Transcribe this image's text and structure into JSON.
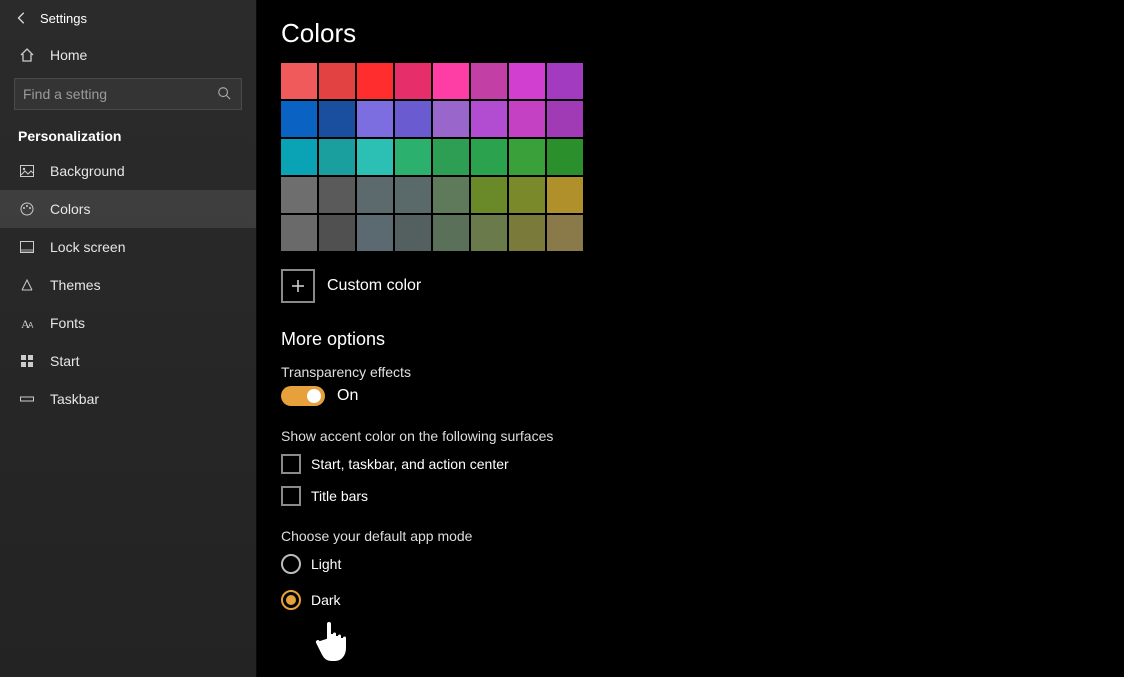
{
  "header": {
    "settings_label": "Settings"
  },
  "sidebar": {
    "home_label": "Home",
    "search_placeholder": "Find a setting",
    "section_label": "Personalization",
    "items": [
      {
        "label": "Background",
        "icon": "picture-icon"
      },
      {
        "label": "Colors",
        "icon": "palette-icon"
      },
      {
        "label": "Lock screen",
        "icon": "lock-screen-icon"
      },
      {
        "label": "Themes",
        "icon": "themes-icon"
      },
      {
        "label": "Fonts",
        "icon": "fonts-icon"
      },
      {
        "label": "Start",
        "icon": "start-icon"
      },
      {
        "label": "Taskbar",
        "icon": "taskbar-icon"
      }
    ],
    "active_index": 1
  },
  "main": {
    "title": "Colors",
    "swatch_rows": [
      [
        "#f15a5a",
        "#e34242",
        "#ff2d2d",
        "#e62e6b",
        "#ff3ea5",
        "#c23fa6",
        "#d13fd1",
        "#a23bbf"
      ],
      [
        "#0a63c2",
        "#1a4fa0",
        "#7c6de0",
        "#6a5bd0",
        "#9966cc",
        "#b24dd1",
        "#c441c4",
        "#a13bb5"
      ],
      [
        "#0aa2b5",
        "#1a9e9e",
        "#2bc0b3",
        "#2bb06e",
        "#2e9e55",
        "#2aa24e",
        "#3aa03a",
        "#2b8f2b"
      ],
      [
        "#6e6e6e",
        "#5a5a5a",
        "#5c6a6e",
        "#5a6a6a",
        "#5e7a5a",
        "#6a8a2a",
        "#7a8a2a",
        "#b0902a"
      ],
      [
        "#6a6a6a",
        "#505050",
        "#5a6a70",
        "#546060",
        "#5a7058",
        "#6a7a4a",
        "#7a7a3a",
        "#8a7a4a"
      ]
    ],
    "custom_color_label": "Custom color",
    "more_options_heading": "More options",
    "transparency": {
      "label": "Transparency effects",
      "state_label": "On",
      "on": true
    },
    "accent_surfaces": {
      "heading": "Show accent color on the following surfaces",
      "options": [
        {
          "label": "Start, taskbar, and action center",
          "checked": false
        },
        {
          "label": "Title bars",
          "checked": false
        }
      ]
    },
    "app_mode": {
      "heading": "Choose your default app mode",
      "options": [
        {
          "label": "Light",
          "checked": false
        },
        {
          "label": "Dark",
          "checked": true
        }
      ]
    }
  }
}
